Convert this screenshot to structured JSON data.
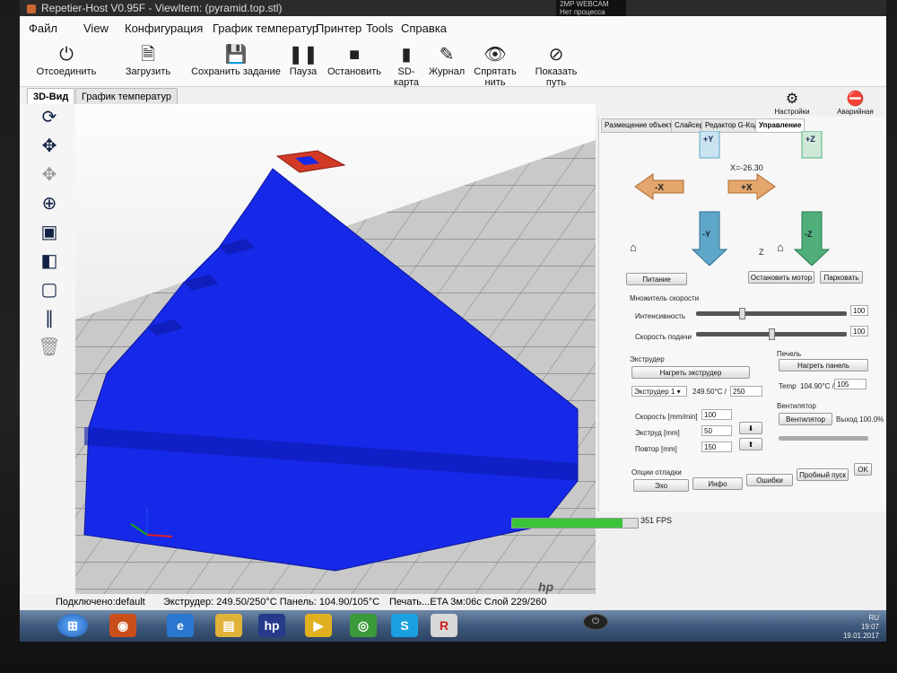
{
  "window": {
    "title": "Repetier-Host V0.95F - ViewItem: (pyramid.top.stl)"
  },
  "webcam": {
    "line1": "2MP WEBCAM",
    "line2": "Нет процесса"
  },
  "menu": [
    "Файл",
    "View",
    "Конфигурация",
    "График температур",
    "Принтер",
    "Tools",
    "Справка"
  ],
  "toolbar": {
    "disconnect": "Отсоединить",
    "load": "Загрузить",
    "save_job": "Сохранить задание",
    "pause": "Пауза",
    "stop": "Остановить",
    "sdcard": "SD-карта",
    "log": "Журнал",
    "hide_filament": "Спрятать нить",
    "show_path": "Показать путь",
    "printer_settings": "Настройки принтера",
    "emergency_stop": "Аварийная остановка"
  },
  "view_tabs": [
    "3D-Вид",
    "График температур"
  ],
  "right_tabs": [
    "Размещение объекта",
    "Слайсер",
    "Редактор G-Кода",
    "Управление"
  ],
  "jog": {
    "plus_y": "+Y",
    "minus_y": "-Y",
    "minus_x": "-X",
    "plus_x": "+X",
    "plus_z": "+Z",
    "minus_z": "-Z",
    "x_readout": "X=-26.30",
    "z_label": "Z"
  },
  "controls": {
    "power": "Питание",
    "stop_motor": "Остановить мотор",
    "park": "Парковать",
    "speed_multiplier": "Множитель скорости",
    "intensity": "Интенсивность",
    "intensity_value": "100",
    "intensity_level": 0.3,
    "feed_rate": "Скорость подачи",
    "feed_value": "100",
    "feed_level": 0.5
  },
  "extruder": {
    "title": "Экструдер",
    "heat_button": "Нагреть экструдер",
    "select": "Экструдер 1",
    "temp_reading": "249.50°C /",
    "temp_target": "250",
    "speed_label": "Скорость [mm/min]",
    "speed_value": "100",
    "extrude_label": "Экструд [mm]",
    "extrude_value": "50",
    "retract_label": "Повтор [mm]",
    "retract_value": "150"
  },
  "bed": {
    "title": "Печель",
    "heat_button": "Нагреть панель",
    "temp_label": "Temp",
    "temp_reading": "104.90°C /",
    "temp_target": "105"
  },
  "fan": {
    "title": "Вентилятор",
    "button": "Вентилятор",
    "output": "Выход 100.0%"
  },
  "debug": {
    "title": "Опции отладки",
    "echo": "Эхо",
    "info": "Инфо",
    "errors": "Ошибки",
    "dry_run": "Пробный пуск",
    "ok": "OK"
  },
  "status": {
    "connection": "Подключено:default",
    "temps": "Экструдер: 249.50/250°C Панель: 104.90/105°C",
    "print": "Печать...ETA 3м:06с Слой 229/260",
    "progress": 0.88,
    "fps": "351 FPS"
  },
  "tray": {
    "lang": "RU",
    "time": "19:07",
    "date": "19.01.2017"
  },
  "colors": {
    "model": "#1326ea",
    "top": "#d23a26",
    "arrow_x": "#e4a66c",
    "arrow_y": "#5fa7c8",
    "arrow_z": "#4fae7a",
    "progress": "#3ac43a"
  }
}
